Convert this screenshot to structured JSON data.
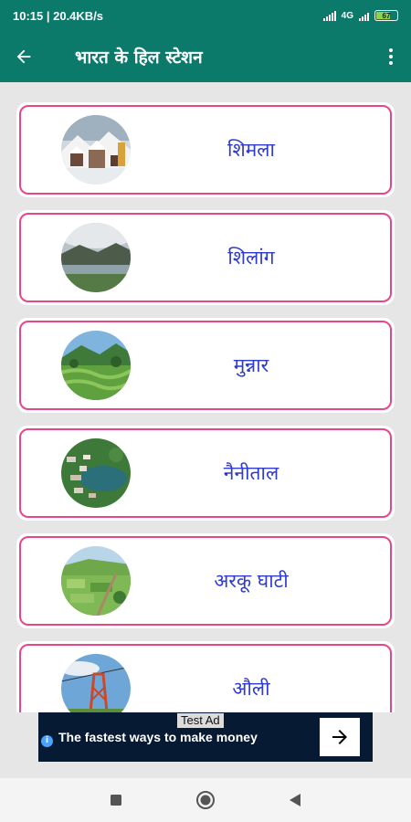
{
  "status_bar": {
    "time_speed": "10:15 | 20.4KB/s",
    "network": "4G",
    "battery": "67"
  },
  "app_bar": {
    "title": "भारत के हिल स्टेशन"
  },
  "stations": [
    {
      "name": "शिमला",
      "image": "snowy-town-photo"
    },
    {
      "name": "शिलांग",
      "image": "cloudy-lake-valley-photo"
    },
    {
      "name": "मुन्नार",
      "image": "green-tea-valley-photo"
    },
    {
      "name": "नैनीताल",
      "image": "lake-town-aerial-photo"
    },
    {
      "name": "अरकू घाटी",
      "image": "green-fields-valley-photo"
    },
    {
      "name": "औली",
      "image": "ropeway-tower-photo"
    }
  ],
  "ad": {
    "tag": "Test Ad",
    "text": "The fastest ways to make money",
    "info_icon": "i"
  },
  "icons": {
    "back": "back-arrow-icon",
    "more": "more-vert-icon",
    "ad_arrow": "arrow-right-icon",
    "nav": [
      "recent-apps-icon",
      "home-icon",
      "back-triangle-icon"
    ]
  },
  "colors": {
    "app_bar": "#0c7a6b",
    "card_border": "#e6468a",
    "label": "#2e3bd0"
  }
}
